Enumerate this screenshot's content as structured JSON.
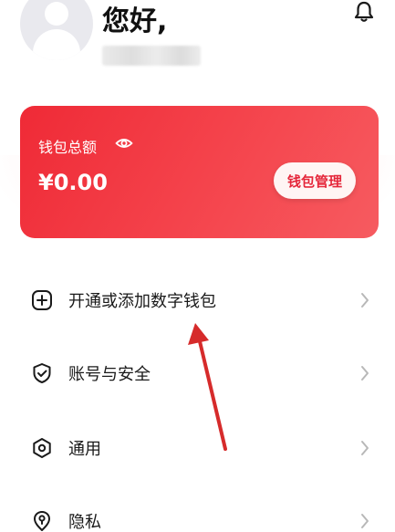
{
  "header": {
    "greeting": "您好,",
    "avatar_icon": "user-avatar-icon",
    "bell_icon": "bell-icon"
  },
  "wallet": {
    "title": "钱包总额",
    "amount": "¥0.00",
    "manage_label": "钱包管理",
    "eye_icon": "eye-icon",
    "accent_color": "#ef2a36"
  },
  "menu": {
    "items": [
      {
        "label": "开通或添加数字钱包",
        "icon": "plus-square-icon"
      },
      {
        "label": "账号与安全",
        "icon": "shield-check-icon"
      },
      {
        "label": "通用",
        "icon": "settings-hexagon-icon"
      },
      {
        "label": "隐私",
        "icon": "privacy-lock-icon"
      }
    ]
  },
  "annotation": {
    "arrow_color": "#d62b2b"
  }
}
